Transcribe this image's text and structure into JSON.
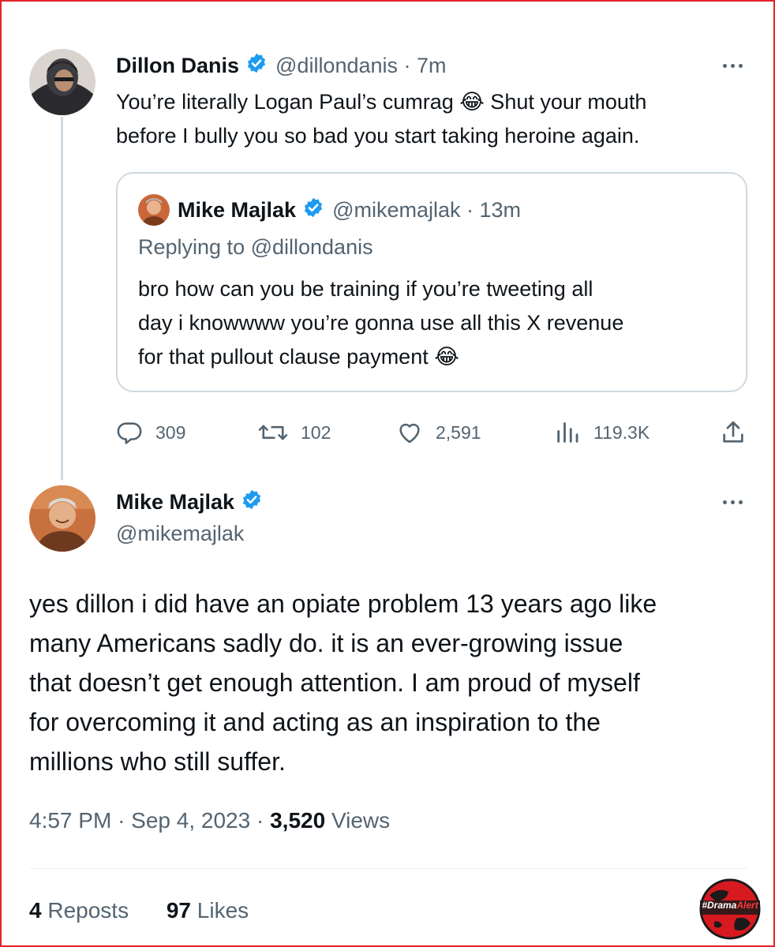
{
  "colors": {
    "frame_border": "#e3242b",
    "text_primary": "#0f1419",
    "text_secondary": "#536471",
    "verified_blue": "#1d9bf0",
    "border": "#cfd9de",
    "logo_red": "#d71920"
  },
  "icons": {
    "verified": "verified-badge-icon",
    "more": "more-horizontal-icon",
    "reply": "reply-bubble-icon",
    "repost": "repost-arrows-icon",
    "like": "heart-icon",
    "views": "bar-chart-icon",
    "share": "share-upload-icon"
  },
  "parent_tweet": {
    "display_name": "Dillon Danis",
    "handle_meta": "@dillondanis · 7m",
    "text_line_1": "You’re literally Logan Paul’s cumrag 😂 Shut your mouth",
    "text_line_2": "before I bully you so bad you start taking heroine again.",
    "quoted": {
      "display_name": "Mike Majlak",
      "handle_meta": "@mikemajlak · 13m",
      "replying_to": "Replying to @dillondanis",
      "text_line_1": "bro how can you be training if you’re tweeting all",
      "text_line_2": "day i knowwww you’re gonna use all this X revenue",
      "text_line_3": "for that pullout clause payment 😂"
    },
    "actions": {
      "replies": "309",
      "reposts": "102",
      "likes": "2,591",
      "views": "119.3K"
    }
  },
  "main_tweet": {
    "display_name": "Mike Majlak",
    "handle": "@mikemajlak",
    "text_line_1": "yes dillon i did have an opiate problem 13 years ago like",
    "text_line_2": "many Americans sadly do. it is an ever-growing issue",
    "text_line_3": "that doesn’t get enough attention. I am proud of myself",
    "text_line_4": "for overcoming it and acting as an inspiration to the",
    "text_line_5": "millions who still suffer.",
    "time": "4:57 PM",
    "date": "Sep 4, 2023",
    "separator": "·",
    "views_count": "3,520",
    "views_label": "Views",
    "reposts_count": "4",
    "reposts_label": "Reposts",
    "likes_count": "97",
    "likes_label": "Likes"
  },
  "watermark": {
    "text_1": "#Drama",
    "text_2": "Alert"
  }
}
